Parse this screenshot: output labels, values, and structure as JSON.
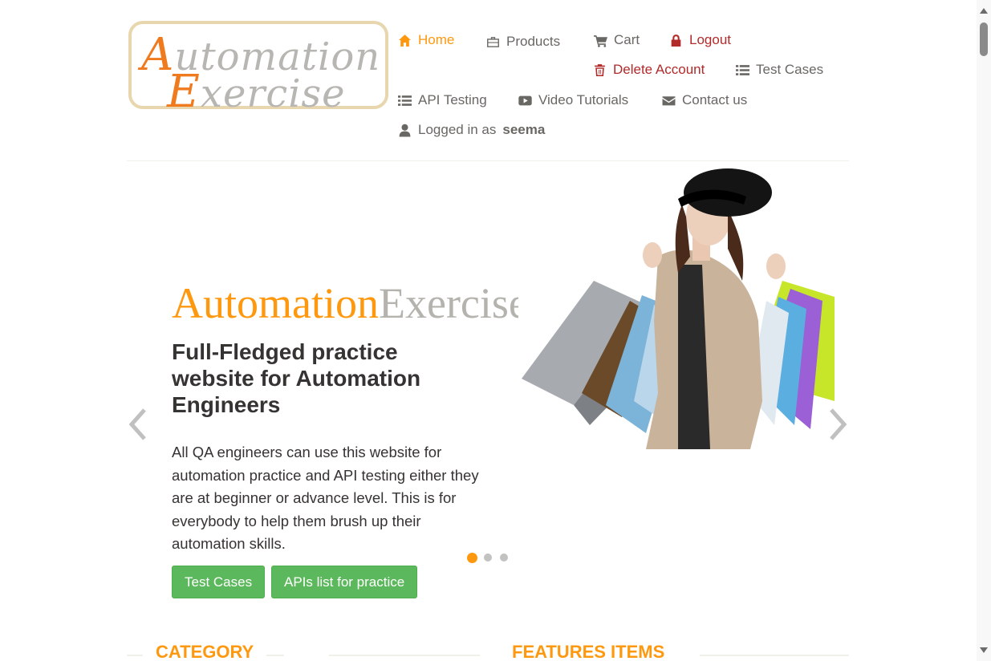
{
  "logo": {
    "line1_cap": "A",
    "line1_rest": "utomation",
    "line2_cap": "E",
    "line2_rest": "xercise"
  },
  "nav": {
    "home": "Home",
    "products": "Products",
    "cart": "Cart",
    "logout": "Logout",
    "delete_account": "Delete Account",
    "test_cases": "Test Cases",
    "api_testing": "API Testing",
    "video_tutorials": "Video Tutorials",
    "contact_us": "Contact us",
    "logged_in_prefix": "Logged in as",
    "username": "seema"
  },
  "slider": {
    "brand_part1": "Automation",
    "brand_part2": "Exercise",
    "headline": "Full-Fledged practice website for Automation Engineers",
    "description": "All QA engineers can use this website for automation practice and API testing either they are at beginner or advance level. This is for everybody to help them brush up their automation skills.",
    "btn_test_cases": "Test Cases",
    "btn_apis": "APIs list for practice",
    "active_slide": 1,
    "slide_count": 3
  },
  "sections": {
    "category": "CATEGORY",
    "features": "FEATURES ITEMS"
  },
  "colors": {
    "accent": "#FE980F",
    "button": "#5cb85c",
    "danger": "#b22a2a",
    "text": "#696763"
  },
  "icons": [
    "home-icon",
    "briefcase-icon",
    "cart-icon",
    "lock-icon",
    "trash-icon",
    "list-icon",
    "youtube-play-icon",
    "envelope-icon",
    "user-icon"
  ]
}
